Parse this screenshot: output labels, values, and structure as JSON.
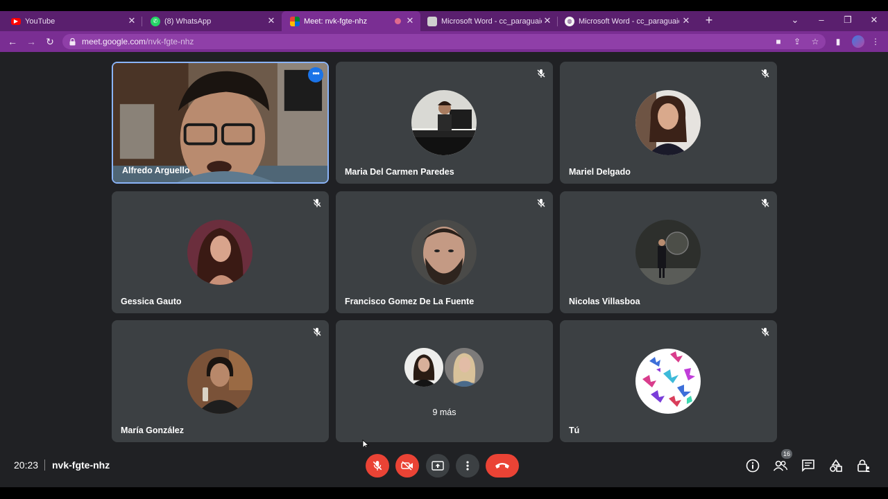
{
  "browser": {
    "tabs": [
      {
        "label": "YouTube",
        "favicon": "youtube-icon"
      },
      {
        "label": "(8) WhatsApp",
        "favicon": "whatsapp-icon"
      },
      {
        "label": "Meet: nvk-fgte-nhz",
        "favicon": "meet-icon",
        "active": true
      },
      {
        "label": "Microsoft Word - cc_paraguaio.d",
        "favicon": "word-icon"
      },
      {
        "label": "Microsoft Word - cc_paraguaio.d",
        "favicon": "globe-icon"
      }
    ],
    "url_host": "meet.google.com",
    "url_path": "/nvk-fgte-nhz"
  },
  "meeting": {
    "participants": [
      {
        "name": "Alfredo Arguello",
        "speaking": true
      },
      {
        "name": "Maria Del Carmen Paredes",
        "muted": true
      },
      {
        "name": "Mariel Delgado",
        "muted": true
      },
      {
        "name": "Gessica Gauto",
        "muted": true
      },
      {
        "name": "Francisco Gomez De La Fuente",
        "muted": true
      },
      {
        "name": "Nicolas Villasboa",
        "muted": true
      },
      {
        "name": "María González",
        "muted": true
      },
      {
        "name": "Tú",
        "muted": true
      }
    ],
    "more_label": "9 más",
    "time": "20:23",
    "code": "nvk-fgte-nhz",
    "people_count": "16"
  },
  "colors": {
    "tab_strip": "#5a1f6e",
    "address_bar": "#7a2e93",
    "meet_bg": "#202124",
    "tile_bg": "#3c4043",
    "danger": "#ea4335",
    "speaking_border": "#8ab4f8"
  }
}
